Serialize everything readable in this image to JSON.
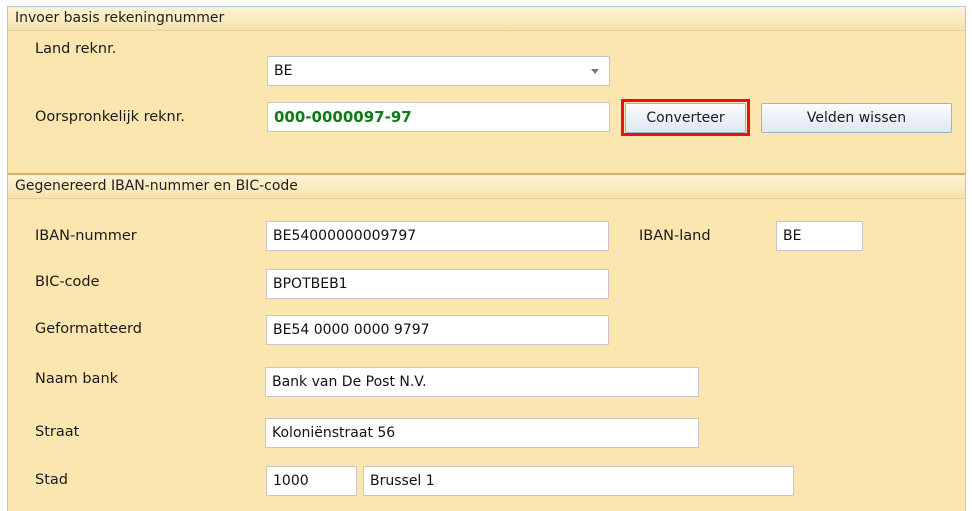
{
  "section_input": {
    "title": "Invoer basis rekeningnummer",
    "land_label": "Land reknr.",
    "land_value": "BE",
    "original_label": "Oorspronkelijk reknr.",
    "original_value": "000-0000097-97",
    "convert_button": "Converteer",
    "clear_button": "Velden wissen"
  },
  "section_output": {
    "title": "Gegenereerd IBAN-nummer en BIC-code",
    "iban_label": "IBAN-nummer",
    "iban_value": "BE54000000009797",
    "iban_country_label": "IBAN-land",
    "iban_country_value": "BE",
    "bic_label": "BIC-code",
    "bic_value": "BPOTBEB1",
    "formatted_label": "Geformatteerd",
    "formatted_value": "BE54 0000 0000 9797",
    "bank_name_label": "Naam bank",
    "bank_name_value": "Bank van De Post N.V.",
    "street_label": "Straat",
    "street_value": "Koloniënstraat 56",
    "city_label": "Stad",
    "postal_code_value": "1000",
    "city_value": "Brussel 1"
  },
  "colors": {
    "panel_background": "#fbe6b0",
    "highlight_border": "#e8111a",
    "account_text": "#0f7a18"
  }
}
